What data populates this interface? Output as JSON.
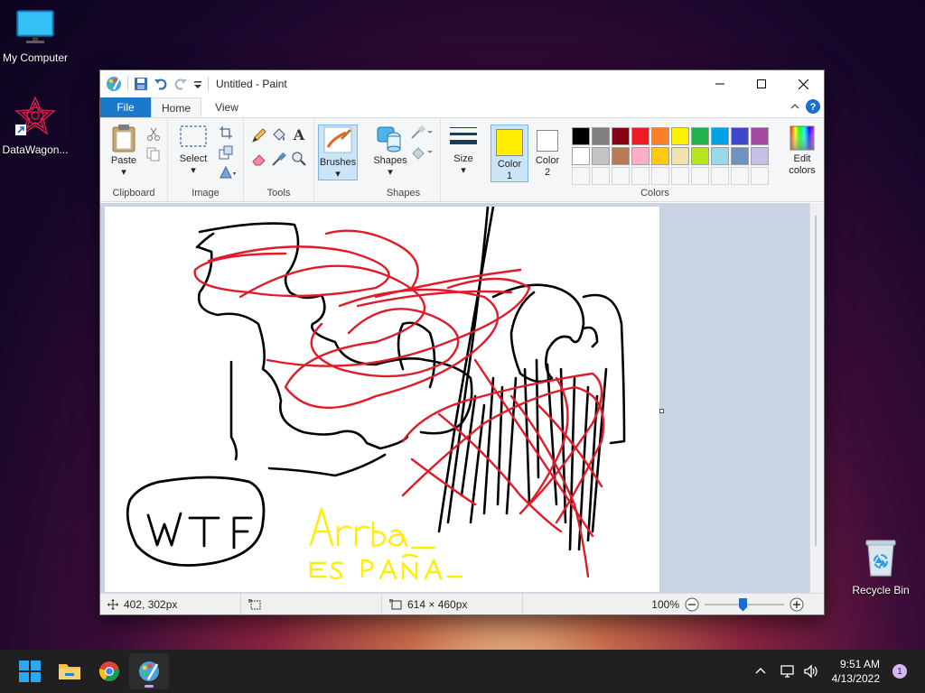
{
  "desktop": {
    "icons": [
      {
        "label": "My Computer"
      },
      {
        "label": "DataWagon..."
      },
      {
        "label": "Recycle Bin"
      }
    ]
  },
  "window": {
    "title": "Untitled - Paint",
    "tabs": {
      "file": "File",
      "home": "Home",
      "view": "View"
    },
    "ribbon": {
      "clipboard": {
        "paste": "Paste",
        "group": "Clipboard"
      },
      "image": {
        "select": "Select",
        "group": "Image"
      },
      "tools": {
        "group": "Tools"
      },
      "brushes": "Brushes",
      "shapes": {
        "label": "Shapes",
        "group": "Shapes"
      },
      "size": "Size",
      "color1": {
        "label1": "Color",
        "label2": "1",
        "value": "#ffee00"
      },
      "color2": {
        "label1": "Color",
        "label2": "2",
        "value": "#ffffff"
      },
      "edit_colors": {
        "line1": "Edit",
        "line2": "colors"
      },
      "colors_group": "Colors",
      "palette_row1": [
        "#000000",
        "#7f7f7f",
        "#880015",
        "#ed1c24",
        "#ff7f27",
        "#fff200",
        "#22b14c",
        "#00a2e8",
        "#3f48cc",
        "#a349a4"
      ],
      "palette_row2": [
        "#ffffff",
        "#c3c3c3",
        "#b97a57",
        "#ffaec9",
        "#ffc90e",
        "#efe4b0",
        "#b5e61d",
        "#99d9ea",
        "#7092be",
        "#c8bfe7"
      ]
    },
    "canvas": {
      "text_wtf": "WTF",
      "text_yellow_1": "Arriba",
      "text_yellow_2": "ES PAÑA"
    },
    "status": {
      "cursor_pos": "402, 302px",
      "selection_size": "",
      "image_size": "614 × 460px",
      "zoom": "100%"
    }
  },
  "taskbar": {
    "time": "9:51 AM",
    "date": "4/13/2022",
    "notifications": "1"
  }
}
